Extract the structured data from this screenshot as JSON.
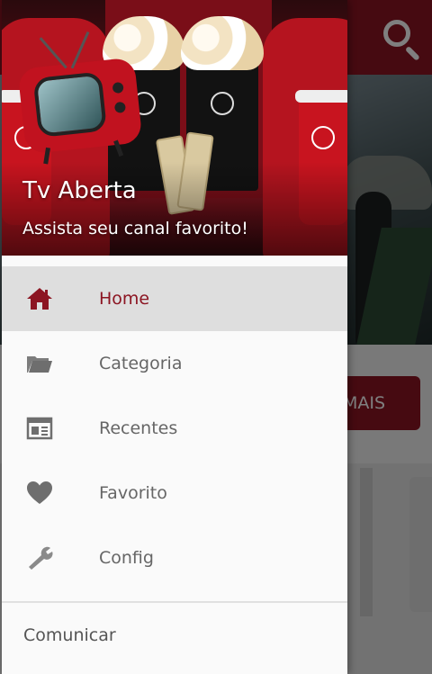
{
  "app_bar": {
    "color": "#8c1522",
    "search_icon": "search-icon"
  },
  "background": {
    "more_button_label": "MAIS"
  },
  "drawer": {
    "header": {
      "title": "Tv Aberta",
      "subtitle": "Assista seu canal favorito!",
      "image": "cinema-popcorn-tv-illustration"
    },
    "items": [
      {
        "label": "Home",
        "icon": "home-icon",
        "active": true
      },
      {
        "label": "Categoria",
        "icon": "folder-icon",
        "active": false
      },
      {
        "label": "Recentes",
        "icon": "recent-calendar-icon",
        "active": false
      },
      {
        "label": "Favorito",
        "icon": "heart-icon",
        "active": false
      },
      {
        "label": "Config",
        "icon": "wrench-icon",
        "active": false
      }
    ],
    "section_label": "Comunicar",
    "accent_color": "#8c1522",
    "icon_color": "#666666"
  }
}
